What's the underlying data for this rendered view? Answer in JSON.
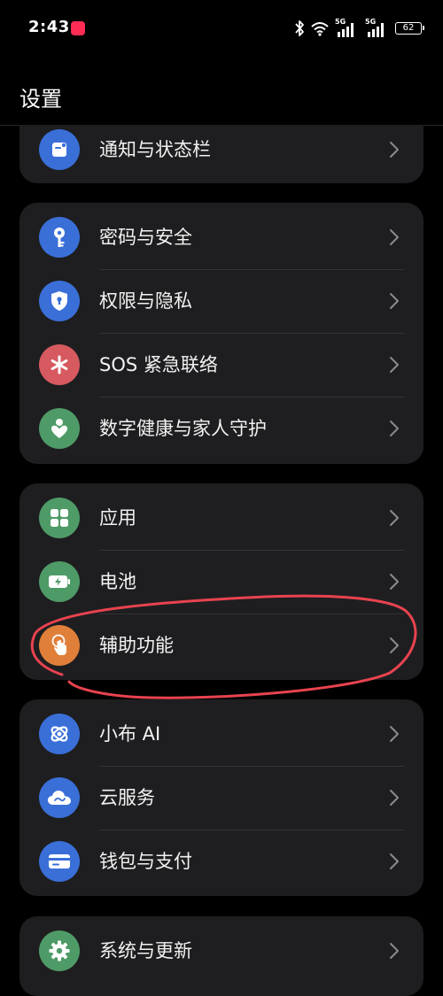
{
  "status_bar": {
    "time": "2:43",
    "app_badge": "app-notification-badge",
    "net1_label": "5G",
    "net2_label": "5G",
    "battery_level": "62"
  },
  "header": {
    "title": "设置"
  },
  "cards": [
    {
      "items": [
        {
          "label": "通知与状态栏",
          "icon": "notification-icon",
          "color": "#3a6fd8"
        }
      ]
    },
    {
      "items": [
        {
          "label": "密码与安全",
          "icon": "key-icon",
          "color": "#3a6fd8"
        },
        {
          "label": "权限与隐私",
          "icon": "shield-lock-icon",
          "color": "#3a6fd8"
        },
        {
          "label": "SOS 紧急联络",
          "icon": "asterisk-icon",
          "color": "#d65a5f"
        },
        {
          "label": "数字健康与家人守护",
          "icon": "family-heart-icon",
          "color": "#4f9b67"
        }
      ]
    },
    {
      "items": [
        {
          "label": "应用",
          "icon": "apps-grid-icon",
          "color": "#4f9b67"
        },
        {
          "label": "电池",
          "icon": "battery-icon",
          "color": "#4f9b67"
        },
        {
          "label": "辅助功能",
          "icon": "hand-touch-icon",
          "color": "#e07f3a"
        }
      ]
    },
    {
      "items": [
        {
          "label": "小布 AI",
          "icon": "xiaobu-ai-icon",
          "color": "#3a6fd8"
        },
        {
          "label": "云服务",
          "icon": "cloud-icon",
          "color": "#3a6fd8"
        },
        {
          "label": "钱包与支付",
          "icon": "wallet-card-icon",
          "color": "#3a6fd8"
        }
      ]
    },
    {
      "items": [
        {
          "label": "系统与更新",
          "icon": "gear-icon",
          "color": "#4f9b67"
        }
      ]
    }
  ],
  "annotation": {
    "color": "#e8434f",
    "target": "辅助功能"
  }
}
